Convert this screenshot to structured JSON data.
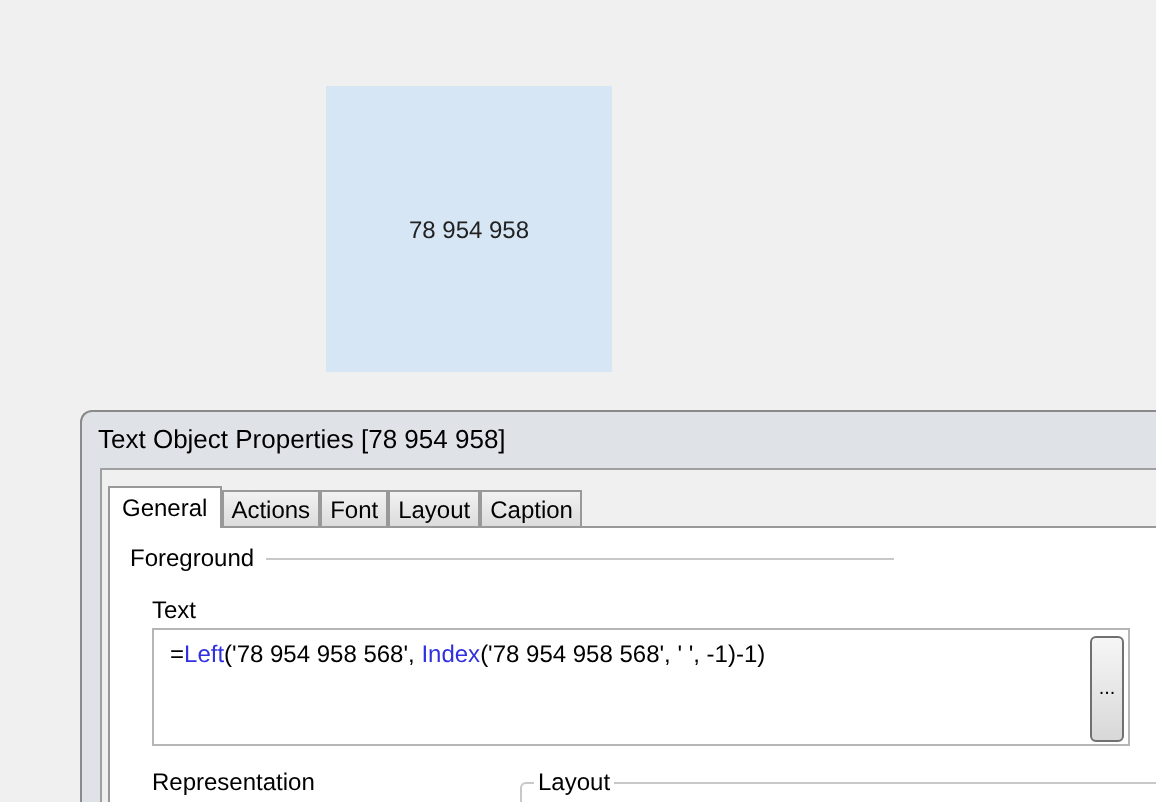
{
  "text_object": {
    "value": "78 954 958"
  },
  "dialog": {
    "title": "Text Object Properties [78 954 958]",
    "tabs": [
      {
        "label": "General",
        "selected": true
      },
      {
        "label": "Actions",
        "selected": false
      },
      {
        "label": "Font",
        "selected": false
      },
      {
        "label": "Layout",
        "selected": false
      },
      {
        "label": "Caption",
        "selected": false
      }
    ],
    "foreground_group": "Foreground",
    "text_label": "Text",
    "expression": [
      {
        "kind": "plain",
        "text": "="
      },
      {
        "kind": "function",
        "text": "Left"
      },
      {
        "kind": "plain",
        "text": "('78 954 958 568', "
      },
      {
        "kind": "function",
        "text": "Index"
      },
      {
        "kind": "plain",
        "text": "('78 954 958 568', ' ', -1)-1)"
      }
    ],
    "expression_button": "...",
    "representation_label": "Representation",
    "layout_group": "Layout"
  }
}
